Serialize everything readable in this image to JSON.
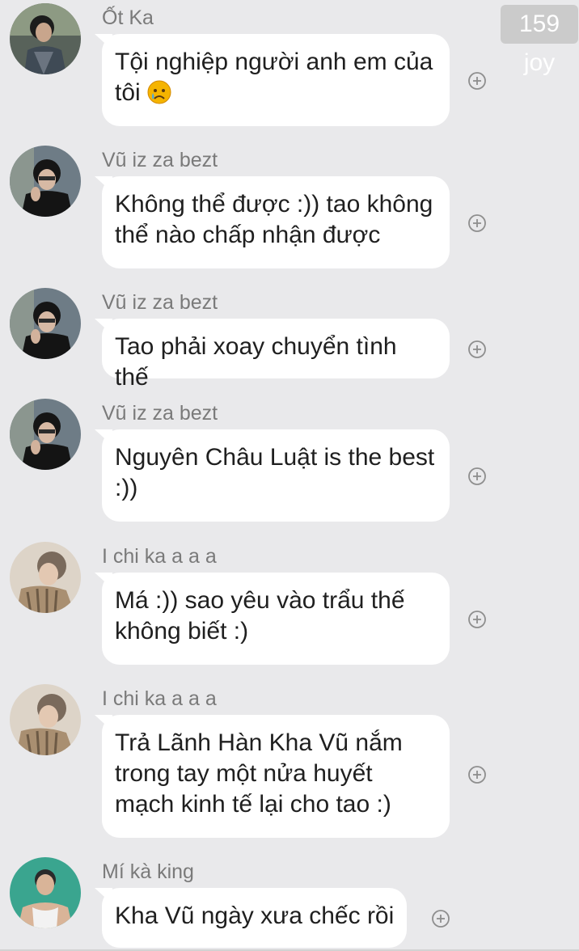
{
  "badge": {
    "text": "159 joy"
  },
  "messages": [
    {
      "sender": "Ốt Ka",
      "text": "Tội nghiệp người anh em của tôi",
      "emoji": "crying-face"
    },
    {
      "sender": "Vũ iz za bezt",
      "text": "Không thể được :)) tao không thể nào chấp nhận được"
    },
    {
      "sender": "Vũ iz za bezt",
      "text": "Tao phải xoay chuyển tình thế"
    },
    {
      "sender": "Vũ iz za bezt",
      "text": "Nguyên Châu Luật is the best :))"
    },
    {
      "sender": "I chi ka a a a",
      "text": "Má :)) sao yêu vào trẩu thế không biết :)"
    },
    {
      "sender": "I chi ka a a a",
      "text": "Trả Lãnh Hàn Kha Vũ nắm trong tay một nửa huyết mạch kinh tế lại cho tao :)"
    },
    {
      "sender": "Mí kà king",
      "text": "Kha Vũ ngày xưa chếc rồi"
    }
  ],
  "icons": {
    "react": "plus-circle-icon",
    "avatar": "avatar"
  },
  "colors": {
    "background": "#e9e9eb",
    "bubble": "#ffffff",
    "sender": "#7a7a7a",
    "badge": "#cbcbcb"
  }
}
